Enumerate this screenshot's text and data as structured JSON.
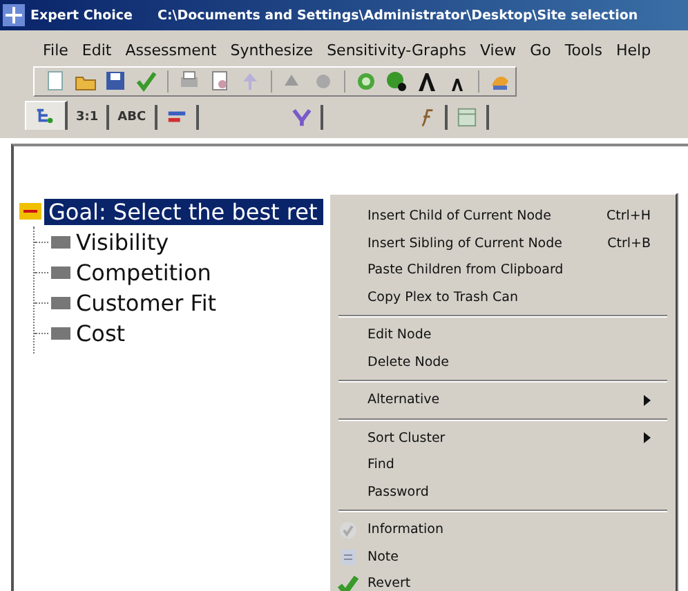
{
  "window": {
    "app": "Expert Choice",
    "path": "C:\\Documents and Settings\\Administrator\\Desktop\\Site selection"
  },
  "menu": [
    "File",
    "Edit",
    "Assessment",
    "Synthesize",
    "Sensitivity-Graphs",
    "View",
    "Go",
    "Tools",
    "Help"
  ],
  "tabs": [
    {
      "selected": true
    },
    {
      "label": "3:1",
      "selected": false
    },
    {
      "label": "ABC",
      "selected": false
    },
    {
      "selected": false
    },
    {
      "selected": false
    },
    {
      "selected": false
    },
    {
      "selected": false
    }
  ],
  "tree": {
    "label": "Goal: Select the best ret",
    "selected": true,
    "expanded": true,
    "children": [
      {
        "label": "Visibility"
      },
      {
        "label": "Competition"
      },
      {
        "label": "Customer Fit"
      },
      {
        "label": "Cost"
      }
    ]
  },
  "context_menu": [
    {
      "kind": "item",
      "label": "Insert Child of Current Node",
      "shortcut": "Ctrl+H"
    },
    {
      "kind": "item",
      "label": "Insert Sibling of Current Node",
      "shortcut": "Ctrl+B"
    },
    {
      "kind": "item",
      "label": "Paste Children from Clipboard"
    },
    {
      "kind": "item",
      "label": "Copy Plex to Trash Can"
    },
    {
      "kind": "separator"
    },
    {
      "kind": "item",
      "label": "Edit Node"
    },
    {
      "kind": "item",
      "label": "Delete Node"
    },
    {
      "kind": "separator"
    },
    {
      "kind": "submenu",
      "label": "Alternative"
    },
    {
      "kind": "separator"
    },
    {
      "kind": "submenu",
      "label": "Sort Cluster"
    },
    {
      "kind": "item",
      "label": "Find"
    },
    {
      "kind": "item",
      "label": "Password"
    },
    {
      "kind": "separator"
    },
    {
      "kind": "icon-item",
      "label": "Information"
    },
    {
      "kind": "icon-item",
      "label": "Note"
    },
    {
      "kind": "icon-item",
      "label": "Revert"
    }
  ]
}
